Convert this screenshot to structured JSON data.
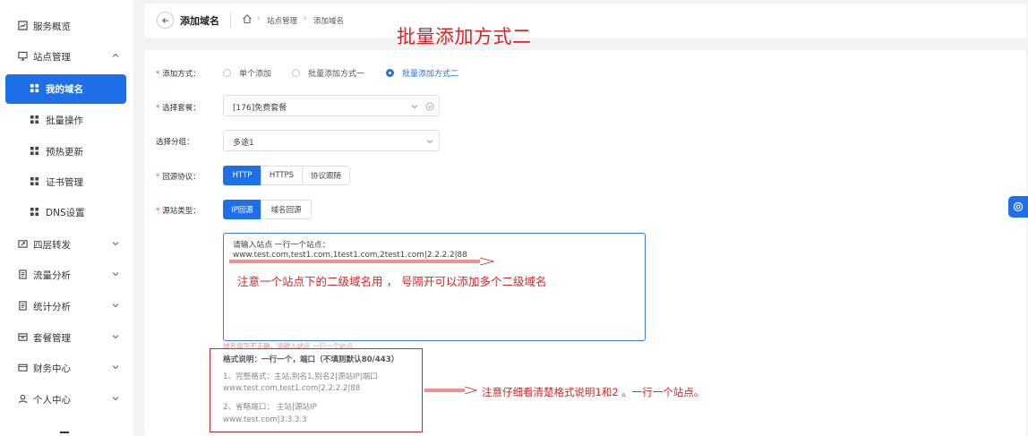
{
  "sidebar": {
    "items": [
      {
        "label": "服务概览",
        "icon": "chart-icon"
      },
      {
        "label": "站点管理",
        "icon": "monitor-icon",
        "expanded": true
      },
      {
        "label": "我的域名",
        "icon": "grid-icon",
        "active": true
      },
      {
        "label": "批量操作",
        "icon": "grid-icon"
      },
      {
        "label": "预热更新",
        "icon": "grid-icon"
      },
      {
        "label": "证书管理",
        "icon": "grid-icon"
      },
      {
        "label": "DNS设置",
        "icon": "grid-icon"
      },
      {
        "label": "四层转发",
        "icon": "share-icon"
      },
      {
        "label": "流量分析",
        "icon": "document-icon"
      },
      {
        "label": "统计分析",
        "icon": "document-icon"
      },
      {
        "label": "套餐管理",
        "icon": "box-icon"
      },
      {
        "label": "财务中心",
        "icon": "wallet-icon"
      },
      {
        "label": "个人中心",
        "icon": "user-icon"
      }
    ]
  },
  "header": {
    "title": "添加域名",
    "breadcrumb": [
      "站点管理",
      "添加域名"
    ]
  },
  "annotations": {
    "title": "批量添加方式二",
    "textarea_note": "注意一个站点下的二级域名用 ， 号隔开可以添加多个二级域名",
    "help_note": "注意仔细看清楚格式说明1和2 。一行一个站点。"
  },
  "form": {
    "add_method": {
      "label": "添加方式：",
      "options": [
        "单个添加",
        "批量添加方式一",
        "批量添加方式二"
      ],
      "selected": 2
    },
    "package": {
      "label": "选择套餐：",
      "value": "[176]免费套餐"
    },
    "group": {
      "label": "选择分组：",
      "value": "多途1"
    },
    "protocol": {
      "label": "回源协议：",
      "options": [
        "HTTP",
        "HTTPS",
        "协议跟随"
      ],
      "selected": 0
    },
    "source_type": {
      "label": "源站类型：",
      "options": [
        "IP回源",
        "域名回源"
      ],
      "selected": 0
    },
    "textarea": {
      "line1": "请输入站点 一行一个站点：",
      "line2": "www.test.com,test1.com,1test1.com,2test1.com|2.2.2.2|88"
    },
    "error_hint": "域名填写不正确，请输入站点 一行一个站点",
    "help": {
      "title": "格式说明：一行一个，端口（不填则默认80/443）",
      "item1_title": "1、完整格式：主站,别名1,别名2|源站IP|端口",
      "item1_example": "www.test.com,test1.com|2.2.2.2|88",
      "item2_title": "2、省略端口： 主站|源站IP",
      "item2_example": "www.test.com|3.3.3.3"
    }
  },
  "colors": {
    "accent": "#1f6fe8",
    "annotation": "#e12121"
  }
}
